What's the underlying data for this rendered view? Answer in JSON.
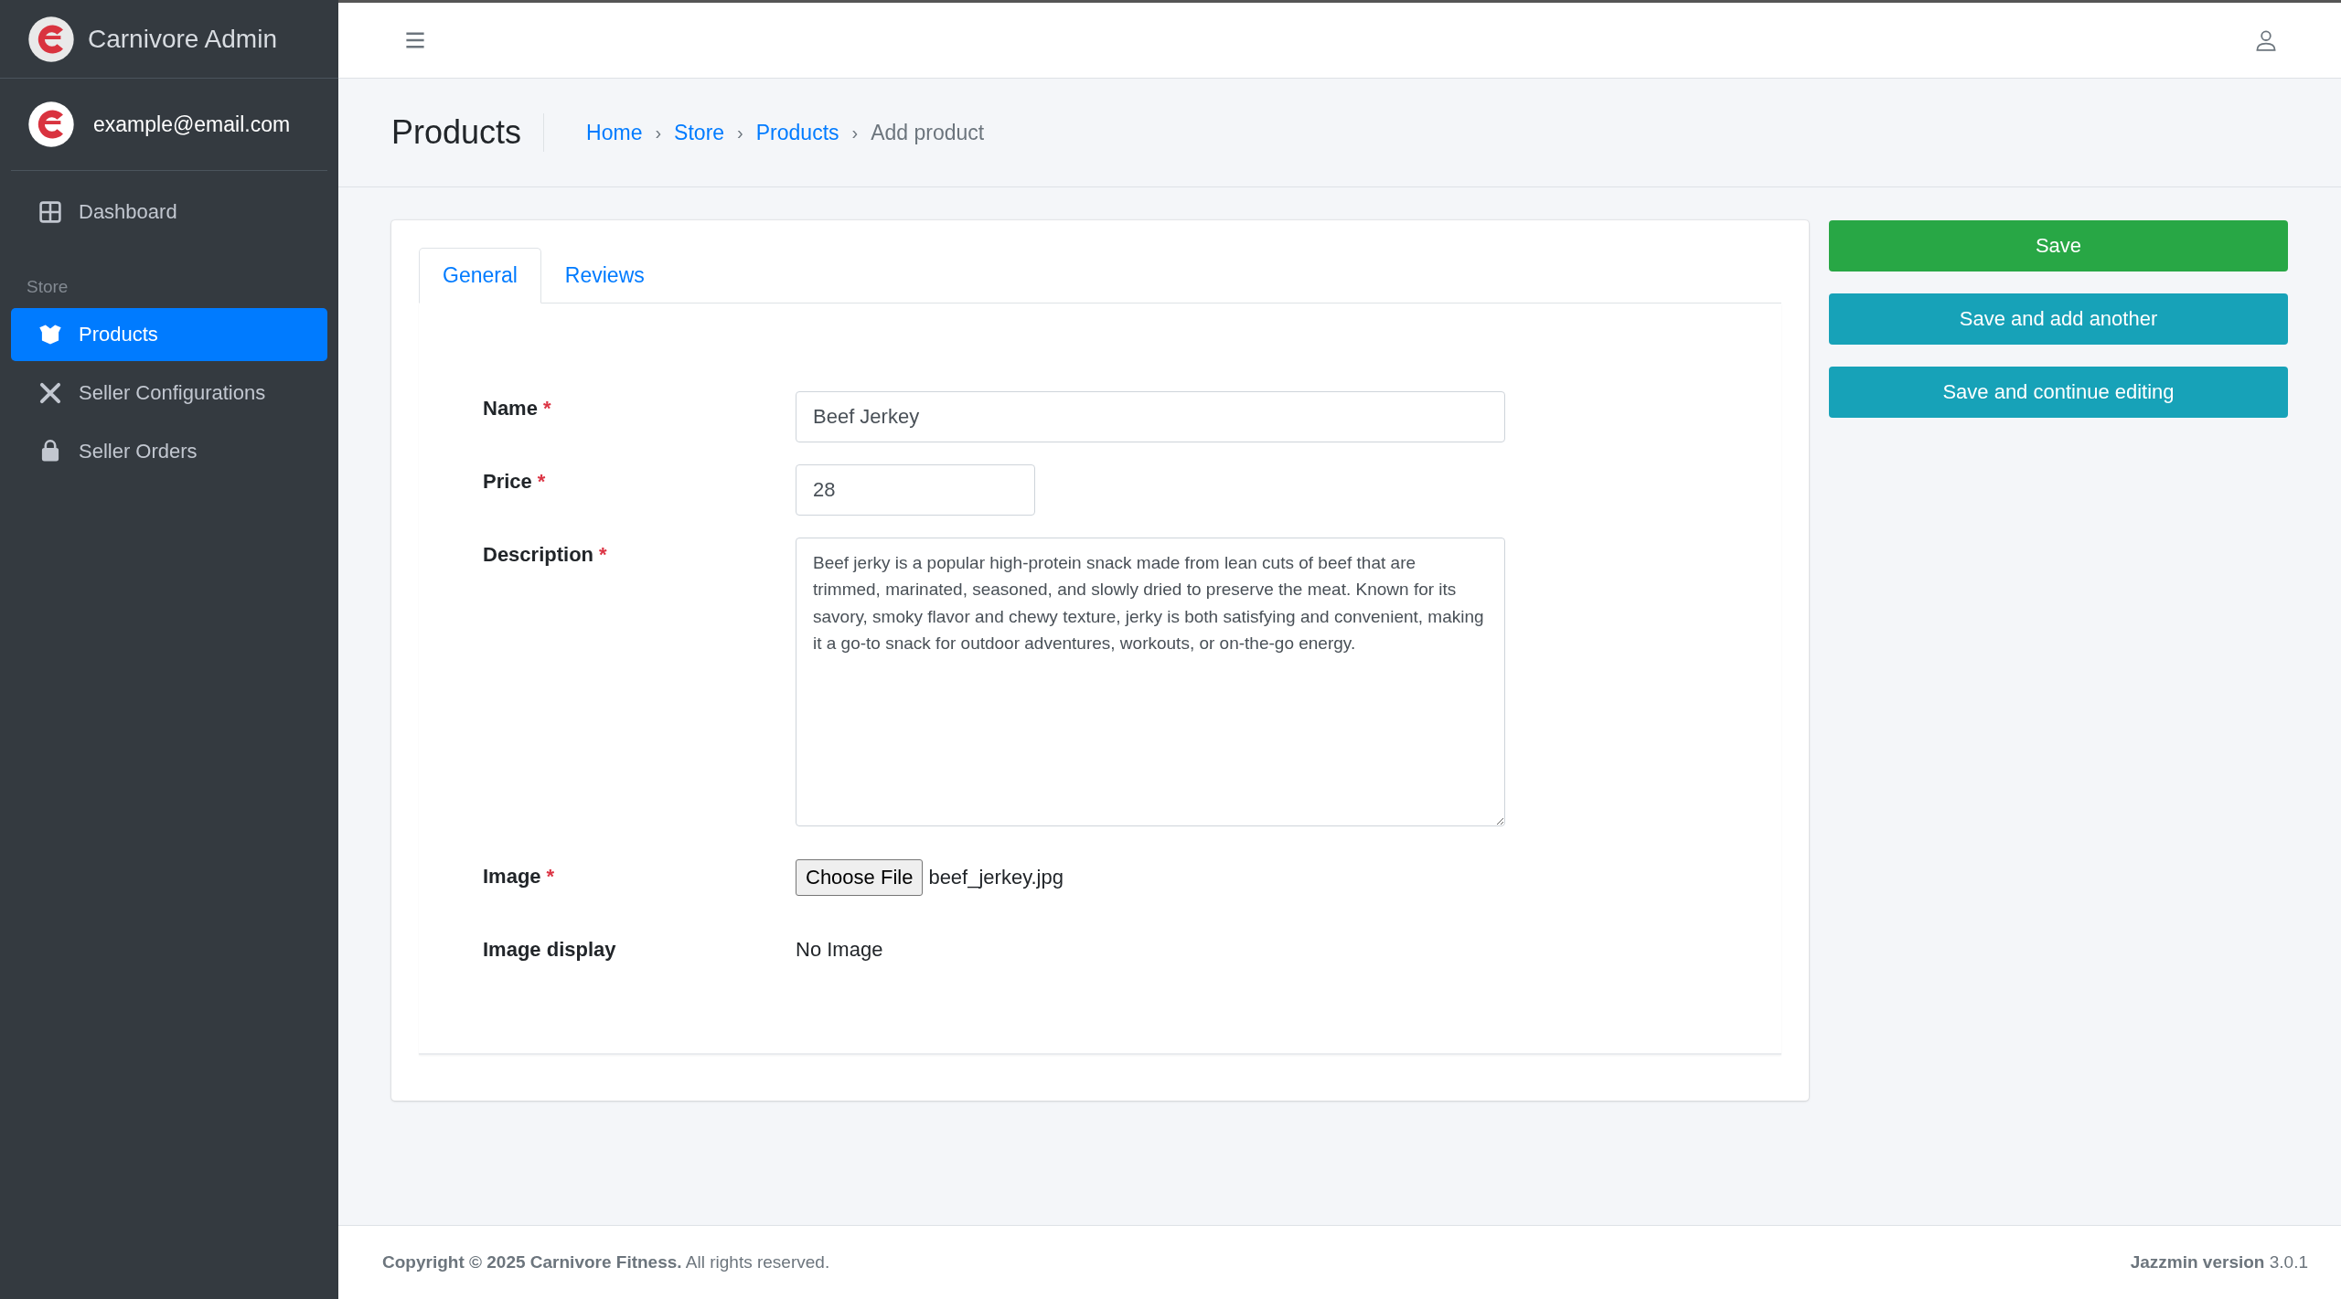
{
  "sidebar": {
    "brand": "Carnivore Admin",
    "user": "example@email.com",
    "items": [
      {
        "kind": "link",
        "label": "Dashboard",
        "selected": false
      },
      {
        "kind": "header",
        "label": "Store"
      },
      {
        "kind": "link",
        "label": "Products",
        "selected": true
      },
      {
        "kind": "link",
        "label": "Seller Configurations",
        "selected": false
      },
      {
        "kind": "link",
        "label": "Seller Orders",
        "selected": false
      }
    ]
  },
  "page_title": "Products",
  "breadcrumb": [
    {
      "label": "Home",
      "current": false
    },
    {
      "label": "Store",
      "current": false
    },
    {
      "label": "Products",
      "current": false
    },
    {
      "label": "Add product",
      "current": true
    }
  ],
  "breadcrumb_separator": "›",
  "tabs": [
    {
      "label": "General",
      "selected": true
    },
    {
      "label": "Reviews",
      "selected": false
    }
  ],
  "fields": [
    {
      "kind": "text",
      "label": "Name",
      "required": true,
      "value": "Beef Jerkey"
    },
    {
      "kind": "number",
      "label": "Price",
      "required": true,
      "value": "28"
    },
    {
      "kind": "textarea",
      "label": "Description",
      "required": true,
      "value": "Beef jerky is a popular high-protein snack made from lean cuts of beef that are trimmed, marinated, seasoned, and slowly dried to preserve the meat. Known for its savory, smoky flavor and chewy texture, jerky is both satisfying and convenient, making it a go-to snack for outdoor adventures, workouts, or on-the-go energy."
    },
    {
      "kind": "file",
      "label": "Image",
      "required": true,
      "button": "Choose File",
      "value": "beef_jerkey.jpg"
    },
    {
      "kind": "static",
      "label": "Image display",
      "required": false,
      "value": "No Image"
    }
  ],
  "required_mark": "*",
  "actions": [
    {
      "kind": "success",
      "label": "Save"
    },
    {
      "kind": "info",
      "label": "Save and add another"
    },
    {
      "kind": "info",
      "label": "Save and continue editing"
    }
  ],
  "footer": {
    "left": "**Copyright © 2025 Carnivore Fitness.** All rights reserved.",
    "right": "**Jazzmin version** 3.0.1"
  }
}
